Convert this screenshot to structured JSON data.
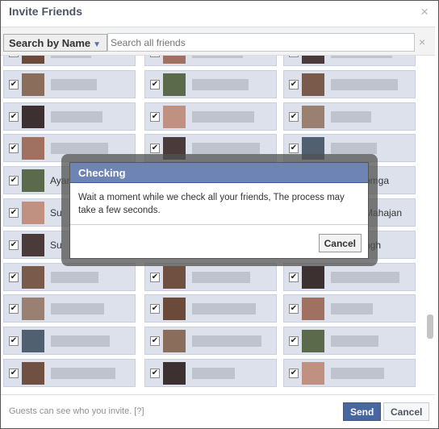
{
  "dialog": {
    "title": "Invite Friends",
    "close": "×"
  },
  "search": {
    "mode": "Search by Name",
    "caret": "▼",
    "placeholder": "Search all friends",
    "clear": "×"
  },
  "friends": [
    [
      "",
      "",
      ""
    ],
    [
      "",
      "",
      ""
    ],
    [
      "",
      "",
      ""
    ],
    [
      "",
      "",
      ""
    ],
    [
      "Ayan",
      "",
      "omga"
    ],
    [
      "Su",
      "",
      "Mahajan"
    ],
    [
      "Su",
      "",
      "ngh"
    ],
    [
      "",
      "",
      ""
    ],
    [
      "",
      "",
      ""
    ],
    [
      "",
      "",
      ""
    ],
    [
      "",
      "",
      ""
    ]
  ],
  "photo_colors": [
    "#6b4a3a",
    "#8a6d5a",
    "#3d3030",
    "#a07060",
    "#5a6a4a",
    "#c09080",
    "#4a3a3a",
    "#7a5a4a",
    "#9a8070",
    "#506070",
    "#705040"
  ],
  "checked": true,
  "footer": {
    "note": "Guests can see who you invite. [?]",
    "send": "Send",
    "cancel": "Cancel"
  },
  "modal": {
    "title": "Checking",
    "message": "Wait a moment while we check all your friends, The process may take a few seconds.",
    "cancel": "Cancel"
  },
  "colors": {
    "header": "#6d84b4",
    "send": "#4a66a0",
    "card": "#dce1ec"
  }
}
